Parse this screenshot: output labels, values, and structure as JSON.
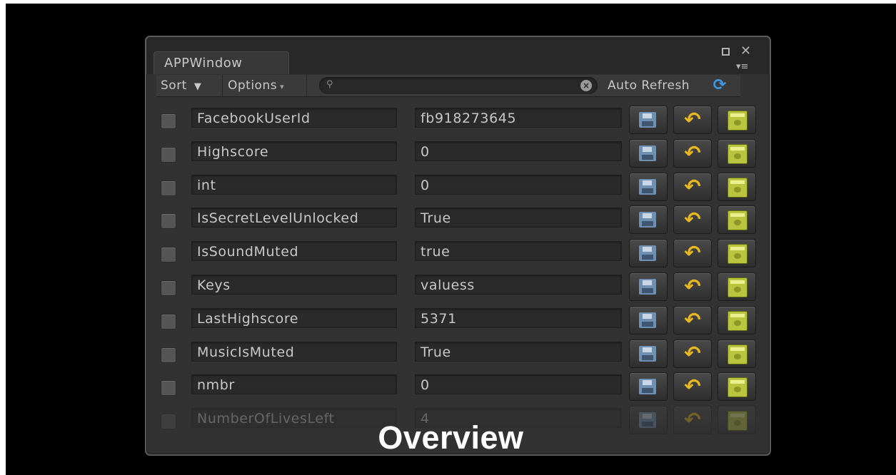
{
  "window": {
    "title": "APPWindow"
  },
  "toolbar": {
    "sort_label": "Sort",
    "sort_arrow": "▼",
    "options_label": "Options",
    "options_arrow": "▾",
    "search_placeholder": "",
    "auto_refresh_label": "Auto Refresh"
  },
  "rows": [
    {
      "key": "FacebookUserId",
      "value": "fb918273645"
    },
    {
      "key": "Highscore",
      "value": "0"
    },
    {
      "key": "int",
      "value": "0"
    },
    {
      "key": "IsSecretLevelUnlocked",
      "value": "True"
    },
    {
      "key": "IsSoundMuted",
      "value": "true"
    },
    {
      "key": "Keys",
      "value": "valuess"
    },
    {
      "key": "LastHighscore",
      "value": "5371"
    },
    {
      "key": "MusicIsMuted",
      "value": "True"
    },
    {
      "key": "nmbr",
      "value": "0"
    },
    {
      "key": "NumberOfLivesLeft",
      "value": "4"
    }
  ],
  "icons": {
    "save": "floppy-disk-icon",
    "revert": "undo-arrow-icon",
    "delete": "trash-icon",
    "refresh": "refresh-icon"
  },
  "caption": "Overview"
}
